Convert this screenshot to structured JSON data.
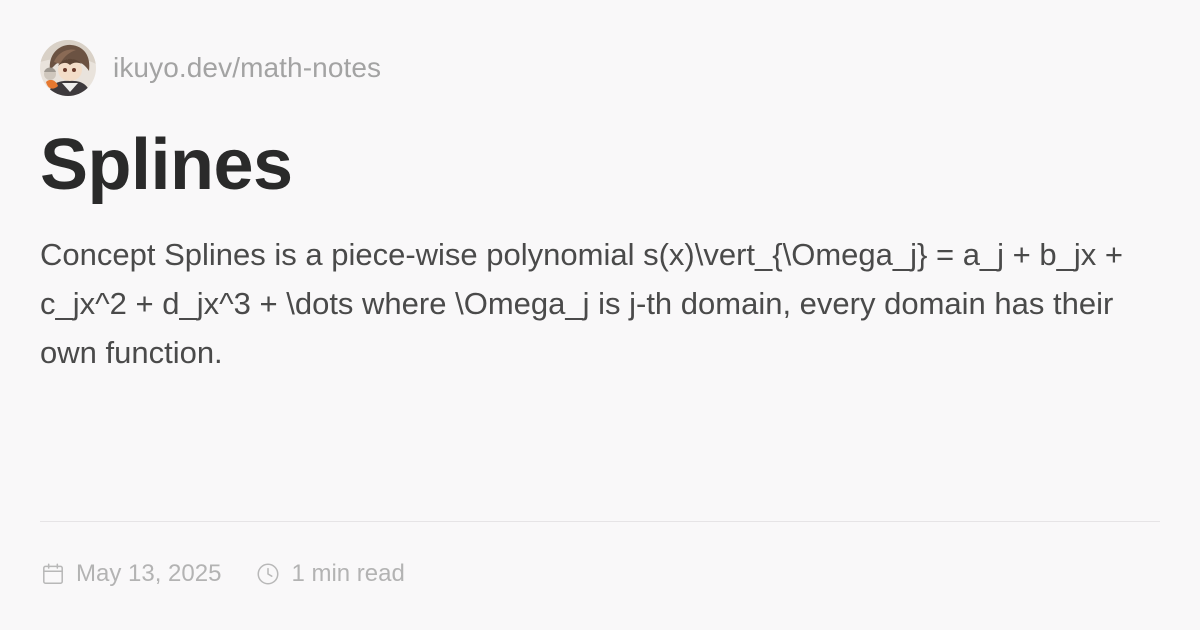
{
  "site": {
    "url": "ikuyo.dev/math-notes",
    "avatar": "author-avatar"
  },
  "post": {
    "title": "Splines",
    "description": "Concept Splines is a piece-wise polynomial s(x)\\vert_{\\Omega_j} = a_j + b_jx + c_jx^2 + d_jx^3 + \\dots where \\Omega_j is j-th domain, every domain has their own function.",
    "date": "May 13, 2025",
    "reading_time": "1 min read"
  },
  "icons": {
    "date": "calendar-icon",
    "reading_time": "clock-icon"
  },
  "colors": {
    "background": "#f9f8f9",
    "title": "#2a2a2a",
    "body_text": "#4a4a4a",
    "muted_text": "#a3a3a3",
    "divider": "#e6e4e6"
  }
}
